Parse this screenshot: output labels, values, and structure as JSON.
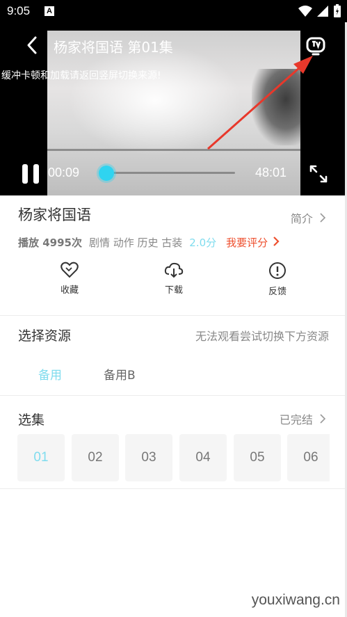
{
  "status_bar": {
    "time": "9:05",
    "app_icon_letter": "A"
  },
  "player": {
    "title": "杨家将国语 第01集",
    "notice": "缓冲卡顿和加载请返回竖屏切换来源!",
    "current_time": "00:09",
    "duration": "48:01",
    "progress_fraction": 0.003,
    "accent_color": "#2fd4f0"
  },
  "show": {
    "title": "杨家将国语",
    "intro_label": "简介",
    "plays": "播放 4995次",
    "tags": "剧情 动作 历史 古装",
    "score": "2.0分",
    "rate_label": "我要评分"
  },
  "actions": [
    {
      "label": "收藏",
      "icon": "heart-icon"
    },
    {
      "label": "下载",
      "icon": "cloud-download-icon"
    },
    {
      "label": "反馈",
      "icon": "exclamation-circle-icon"
    }
  ],
  "source": {
    "title": "选择资源",
    "hint": "无法观看尝试切换下方资源",
    "tabs": [
      "备用",
      "备用B"
    ],
    "selected": 0
  },
  "episodes": {
    "title": "选集",
    "status": "已完结",
    "items": [
      "01",
      "02",
      "03",
      "04",
      "05",
      "06"
    ],
    "selected": 0
  },
  "watermark": "youxiwang.cn"
}
